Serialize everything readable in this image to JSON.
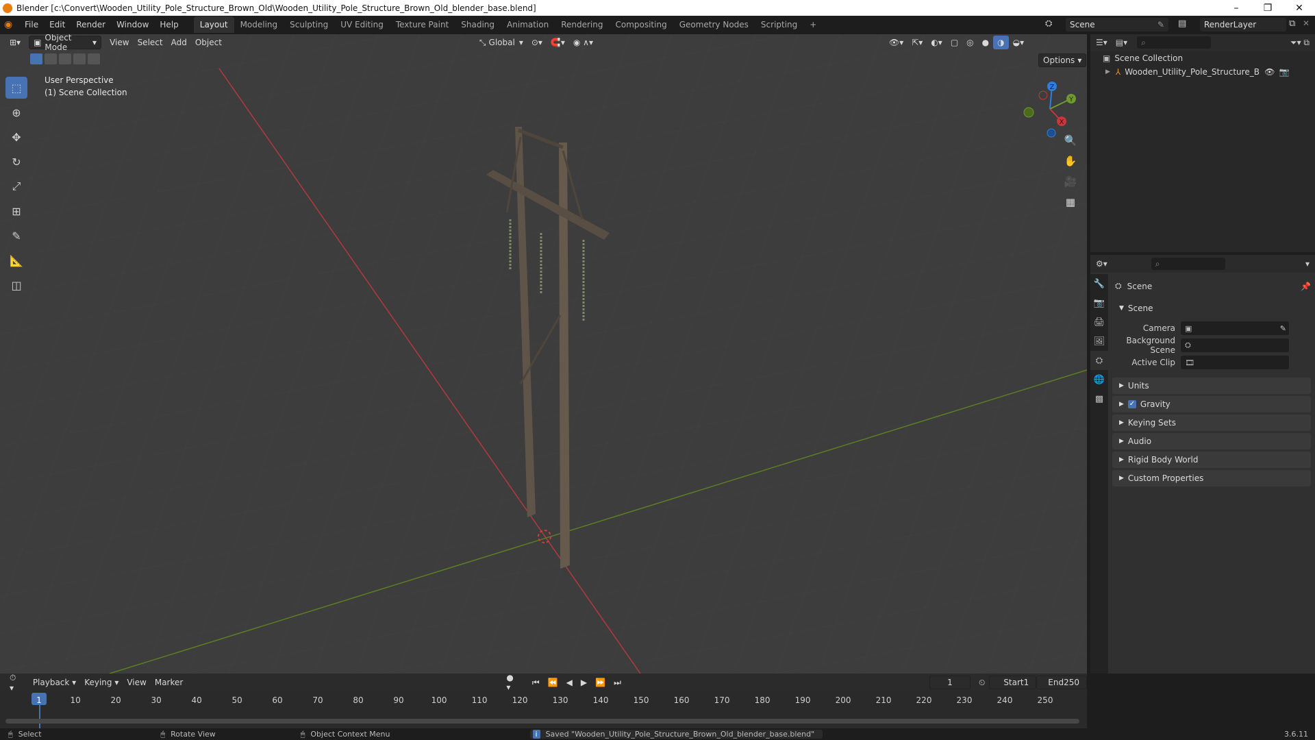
{
  "window": {
    "title": "Blender [c:\\Convert\\Wooden_Utility_Pole_Structure_Brown_Old\\Wooden_Utility_Pole_Structure_Brown_Old_blender_base.blend]",
    "minimize": "–",
    "maximize": "❐",
    "close": "✕"
  },
  "menu": [
    "File",
    "Edit",
    "Render",
    "Window",
    "Help"
  ],
  "workspaces": [
    "Layout",
    "Modeling",
    "Sculpting",
    "UV Editing",
    "Texture Paint",
    "Shading",
    "Animation",
    "Rendering",
    "Compositing",
    "Geometry Nodes",
    "Scripting",
    "+"
  ],
  "scene_field": "Scene",
  "render_layer_field": "RenderLayer",
  "viewport": {
    "mode": "Object Mode",
    "menus": [
      "View",
      "Select",
      "Add",
      "Object"
    ],
    "orientation": "Global",
    "options_label": "Options",
    "perspective": "User Perspective",
    "collection": "(1) Scene Collection",
    "gizmo": {
      "z": "Z",
      "y": "Y",
      "x": "X"
    }
  },
  "outliner": {
    "root": "Scene Collection",
    "item": "Wooden_Utility_Pole_Structure_Brown_("
  },
  "properties": {
    "header": "Scene",
    "scene_panel": "Scene",
    "camera_label": "Camera",
    "background_label": "Background Scene",
    "active_clip_label": "Active Clip",
    "panels": [
      "Units",
      "Gravity",
      "Keying Sets",
      "Audio",
      "Rigid Body World",
      "Custom Properties"
    ]
  },
  "timeline": {
    "menus": [
      "Playback",
      "Keying",
      "View",
      "Marker"
    ],
    "current_frame": "1",
    "start_label": "Start",
    "start_value": "1",
    "end_label": "End",
    "end_value": "250",
    "ticks": [
      "1",
      "10",
      "20",
      "30",
      "40",
      "50",
      "60",
      "70",
      "80",
      "90",
      "100",
      "110",
      "120",
      "130",
      "140",
      "150",
      "160",
      "170",
      "180",
      "190",
      "200",
      "210",
      "220",
      "230",
      "240",
      "250"
    ]
  },
  "status": {
    "select": "Select",
    "rotate": "Rotate View",
    "context": "Object Context Menu",
    "message": "Saved \"Wooden_Utility_Pole_Structure_Brown_Old_blender_base.blend\"",
    "version": "3.6.11"
  },
  "colors": {
    "accent": "#4772b3",
    "x_axis": "#c8373d",
    "y_axis": "#6f9b2d",
    "z_axis": "#2d7fe0"
  }
}
